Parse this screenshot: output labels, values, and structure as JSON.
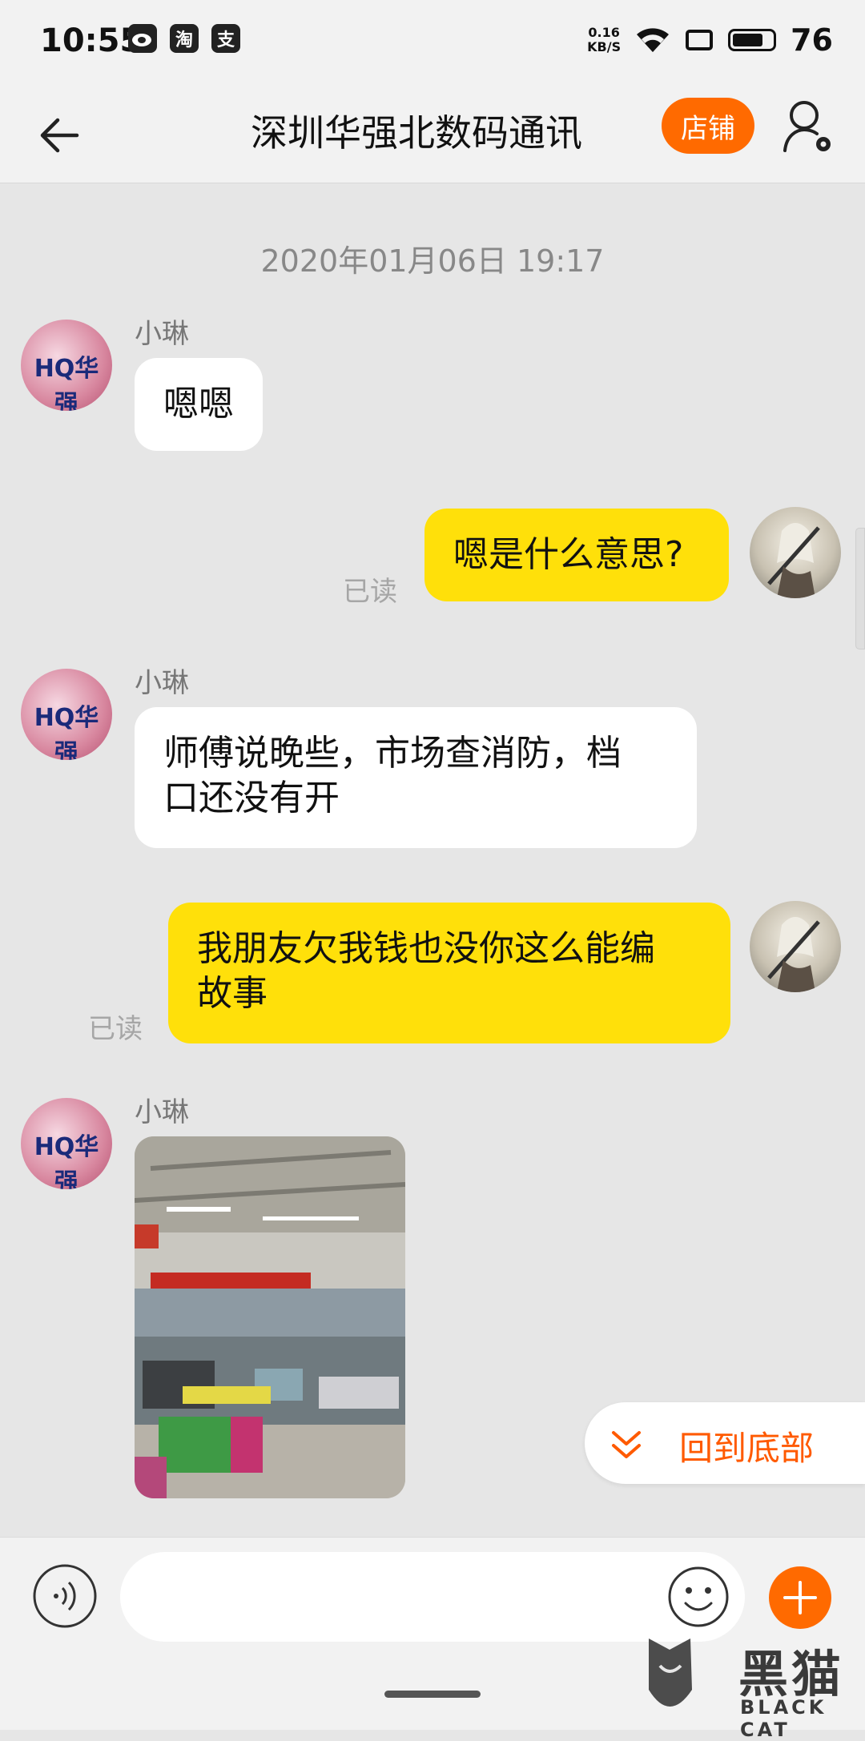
{
  "status_bar": {
    "time": "10:55",
    "app_icons": [
      "weibo",
      "淘",
      "支"
    ],
    "net_speed_value": "0.16",
    "net_speed_unit": "KB/S",
    "battery": "76"
  },
  "header": {
    "title": "深圳华强北数码通讯",
    "shop_button": "店铺"
  },
  "chat": {
    "timestamp": "2020年01月06日 19:17",
    "messages": [
      {
        "side": "in",
        "sender": "小琳",
        "text": "嗯嗯"
      },
      {
        "side": "out",
        "read": "已读",
        "text": "嗯是什么意思?"
      },
      {
        "side": "in",
        "sender": "小琳",
        "text_line1": "师傅说晚些，市场查消防，档",
        "text_line2": "口还没有开"
      },
      {
        "side": "out",
        "read": "已读",
        "text_line1": "我朋友欠我钱也没你这么能编",
        "text_line2": "故事"
      },
      {
        "side": "in",
        "sender": "小琳",
        "type": "image"
      }
    ],
    "avatar_logo": "HQ华强",
    "back_to_bottom": "回到底部"
  },
  "input": {
    "placeholder": ""
  },
  "watermark": {
    "text": "黑猫",
    "sub": "BLACK CAT"
  },
  "colors": {
    "accent": "#ff6a00",
    "outgoing_bubble": "#ffe00a",
    "incoming_bubble": "#ffffff",
    "background": "#e6e6e6"
  }
}
